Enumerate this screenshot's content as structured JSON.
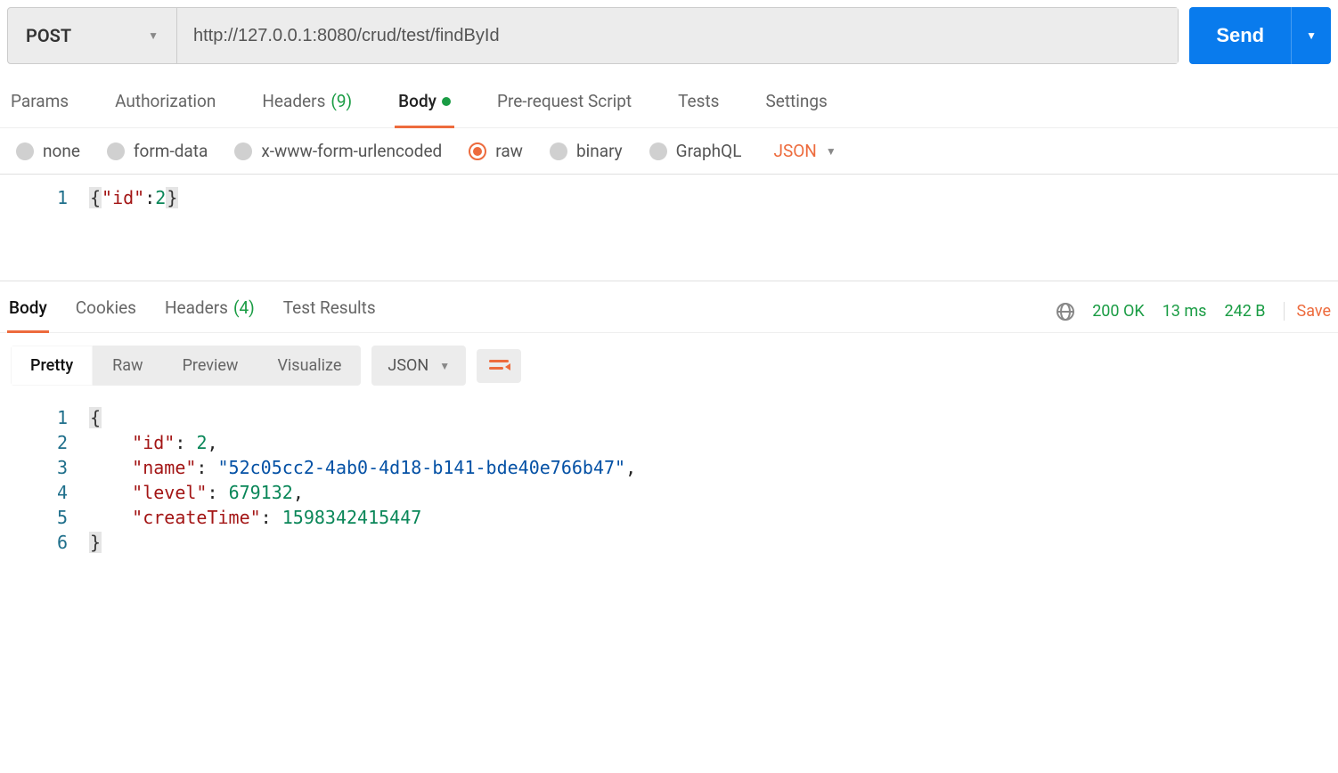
{
  "request": {
    "method": "POST",
    "url": "http://127.0.0.1:8080/crud/test/findById",
    "send_label": "Send"
  },
  "tabs": {
    "params": "Params",
    "authorization": "Authorization",
    "headers_label": "Headers",
    "headers_count": "(9)",
    "body": "Body",
    "prerequest": "Pre-request Script",
    "tests": "Tests",
    "settings": "Settings"
  },
  "body_types": {
    "none": "none",
    "formdata": "form-data",
    "urlencoded": "x-www-form-urlencoded",
    "raw": "raw",
    "binary": "binary",
    "graphql": "GraphQL",
    "format": "JSON"
  },
  "request_body": {
    "line1_num": "1",
    "key_id": "\"id\"",
    "val_id": "2"
  },
  "response_tabs": {
    "body": "Body",
    "cookies": "Cookies",
    "headers_label": "Headers",
    "headers_count": "(4)",
    "test_results": "Test Results"
  },
  "status": {
    "code": "200 OK",
    "time": "13 ms",
    "size": "242 B",
    "save": "Save"
  },
  "view_modes": {
    "pretty": "Pretty",
    "raw": "Raw",
    "preview": "Preview",
    "visualize": "Visualize",
    "format": "JSON"
  },
  "response_body": {
    "lines": [
      "1",
      "2",
      "3",
      "4",
      "5",
      "6"
    ],
    "k_id": "\"id\"",
    "v_id": "2",
    "k_name": "\"name\"",
    "v_name": "\"52c05cc2-4ab0-4d18-b141-bde40e766b47\"",
    "k_level": "\"level\"",
    "v_level": "679132",
    "k_ct": "\"createTime\"",
    "v_ct": "1598342415447"
  }
}
